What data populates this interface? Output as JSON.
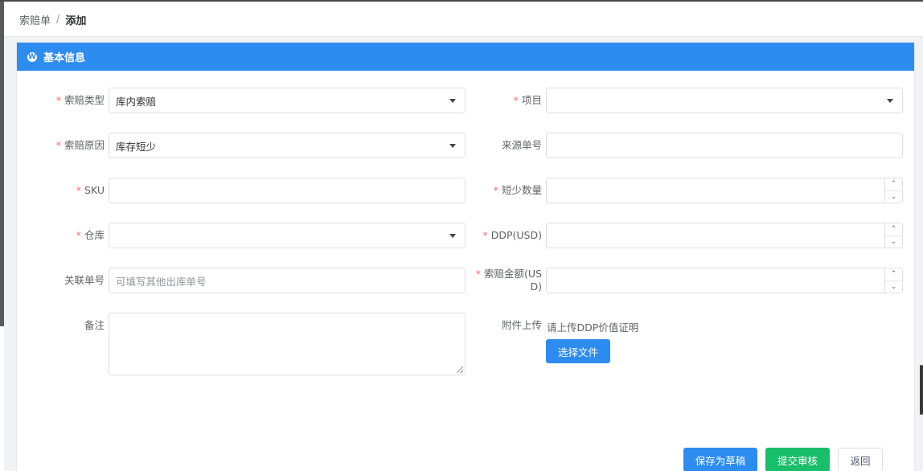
{
  "breadcrumb": {
    "parent": "索赔单",
    "separator": "/",
    "current": "添加"
  },
  "section": {
    "title": "基本信息",
    "icon": "wordpress-icon"
  },
  "form": {
    "claim_type": {
      "label": "索赔类型",
      "required": true,
      "value": "库内索赔"
    },
    "claim_reason": {
      "label": "索赔原因",
      "required": true,
      "value": "库存短少"
    },
    "sku": {
      "label": "SKU",
      "required": true,
      "value": ""
    },
    "warehouse": {
      "label": "仓库",
      "required": true,
      "value": ""
    },
    "related_no": {
      "label": "关联单号",
      "required": false,
      "value": "",
      "placeholder": "可填写其他出库单号"
    },
    "remark": {
      "label": "备注",
      "required": false,
      "value": ""
    },
    "project": {
      "label": "项目",
      "required": true,
      "value": ""
    },
    "source_no": {
      "label": "来源单号",
      "required": false,
      "value": ""
    },
    "short_qty": {
      "label": "短少数量",
      "required": true,
      "value": ""
    },
    "ddp_usd": {
      "label": "DDP(USD)",
      "required": true,
      "value": ""
    },
    "claim_amount": {
      "label_line1": "索赔金额(US",
      "label_line2": "D)",
      "required": true,
      "value": ""
    },
    "attachment": {
      "label": "附件上传",
      "hint": "请上传DDP价值证明",
      "button": "选择文件"
    }
  },
  "actions": {
    "save_draft": "保存为草稿",
    "submit_review": "提交审核",
    "back": "返回"
  },
  "colors": {
    "primary": "#2d8cf0",
    "success": "#19be6b",
    "required": "#f56c6c"
  }
}
